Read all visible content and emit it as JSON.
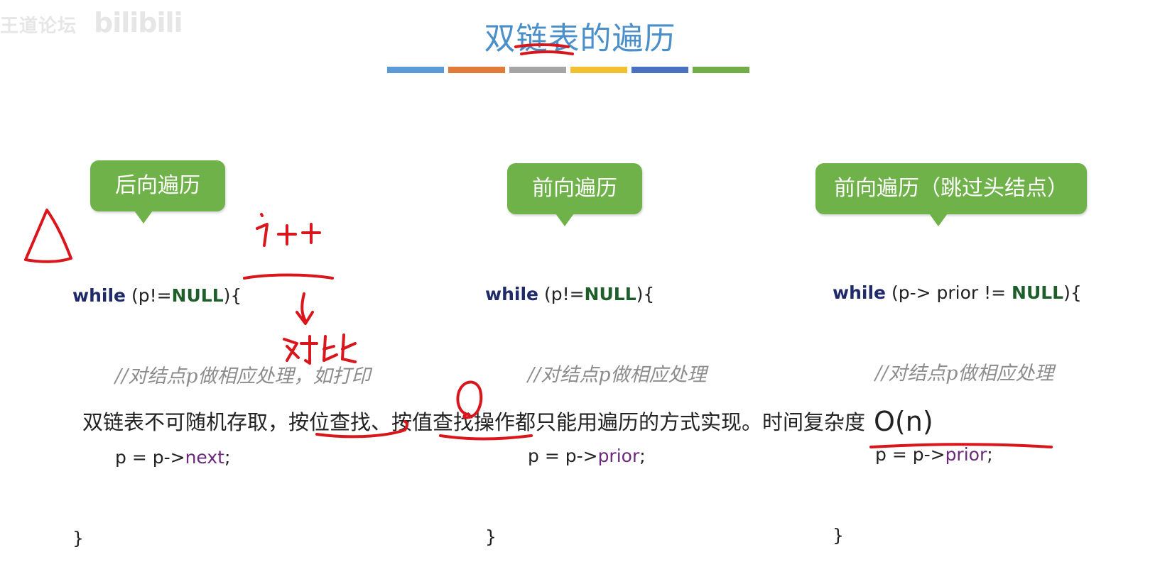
{
  "watermark": {
    "left_text": "王道论坛",
    "brand": "bilibili"
  },
  "slide": {
    "title": "双链表的遍历",
    "color_bars": [
      "#5b9bd5",
      "#e07b39",
      "#a5a5a5",
      "#f2c030",
      "#4a72c0",
      "#70ad47"
    ],
    "panels": [
      {
        "label": "后向遍历",
        "kw": "while",
        "cond_a": " (p!=",
        "cond_null": "NULL",
        "cond_b": "){",
        "comment": "//对结点p做相应处理，如打印",
        "assign": "p = p->",
        "member": "next",
        "end": ";",
        "close": "}"
      },
      {
        "label": "前向遍历",
        "kw": "while",
        "cond_a": " (p!=",
        "cond_null": "NULL",
        "cond_b": "){",
        "comment": "//对结点p做相应处理",
        "assign": "p = p->",
        "member": "prior",
        "end": ";",
        "close": "}"
      },
      {
        "label": "前向遍历（跳过头结点）",
        "kw": "while",
        "cond_a": " (p-> prior != ",
        "cond_null": "NULL",
        "cond_b": "){",
        "comment": "//对结点p做相应处理",
        "assign": "p = p->",
        "member": "prior",
        "end": ";",
        "close": "}"
      }
    ],
    "summary": {
      "text": "双链表不可随机存取，按位查找、按值查找操作都只能用遍历的方式实现。时间复杂度",
      "complexity": "O(n)"
    }
  },
  "annotations": {
    "handwriting_1": "i++",
    "handwriting_2": "对比",
    "ink_color": "#d9161b"
  }
}
